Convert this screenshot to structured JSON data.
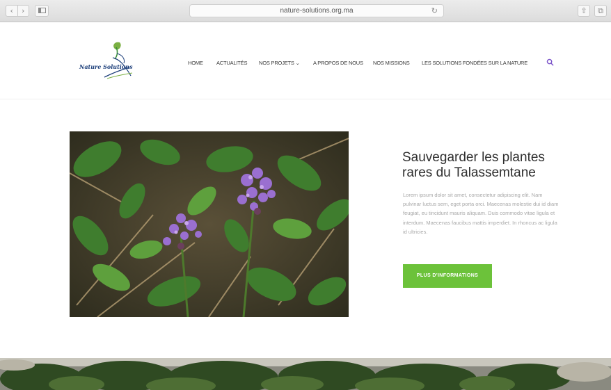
{
  "browser": {
    "address": "nature-solutions.org.ma",
    "back_glyph": "‹",
    "forward_glyph": "›",
    "reload_glyph": "↻",
    "share_glyph": "⇧",
    "tabs_glyph": "⧉"
  },
  "header": {
    "logo_text": "Nature Solutions",
    "nav": [
      {
        "label": "HOME"
      },
      {
        "label": "ACTUALITÉS"
      },
      {
        "label": "NOS PROJETS ⌄"
      },
      {
        "label": "A PROPOS DE NOUS"
      },
      {
        "label": "NOS MISSIONS"
      },
      {
        "label": "LES SOLUTIONS FONDÉES SUR LA NATURE"
      }
    ]
  },
  "feature": {
    "title": "Sauvegarder les plantes rares du Talassemtane",
    "body": "Lorem ipsum dolor sit amet, consectetur adipiscing elit. Nam pulvinar luctus sem, eget porta orci. Maecenas molestie dui id diam feugiat, eu tincidunt mauris aliquam. Duis commodo vitae ligula et interdum. Maecenas faucibus mattis imperdiet. In rhoncus ac ligula id ultricies.",
    "button": "PLUS D'INFORMATIONS"
  },
  "colors": {
    "accent": "#6cc23a",
    "nav_text": "#3a3a3a",
    "search": "#7b54c9",
    "logo_blue": "#1d3f7a"
  }
}
